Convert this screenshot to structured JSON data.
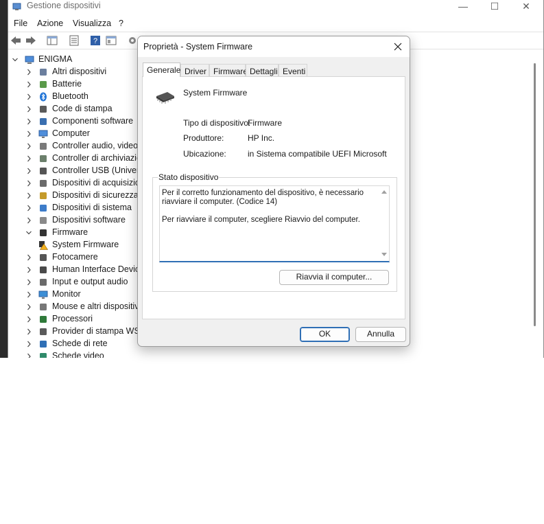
{
  "window": {
    "title": "Gestione dispositivi",
    "controls": {
      "minimize": "—",
      "maximize": "☐",
      "close": "✕"
    }
  },
  "menu": [
    "File",
    "Azione",
    "Visualizza",
    "?"
  ],
  "toolbar_icons": [
    "back-arrow-icon",
    "forward-arrow-icon",
    "show-hide-tree-icon",
    "properties-icon",
    "help-icon",
    "view-icon",
    "scan-hardware-icon"
  ],
  "tree": {
    "root": "ENIGMA",
    "items": [
      {
        "label": "Altri dispositivi",
        "icon": "unknown-device-icon",
        "expanded": false
      },
      {
        "label": "Batterie",
        "icon": "battery-icon",
        "expanded": false
      },
      {
        "label": "Bluetooth",
        "icon": "bluetooth-icon",
        "expanded": false
      },
      {
        "label": "Code di stampa",
        "icon": "printer-icon",
        "expanded": false
      },
      {
        "label": "Componenti software",
        "icon": "software-component-icon",
        "expanded": false
      },
      {
        "label": "Computer",
        "icon": "computer-icon",
        "expanded": false
      },
      {
        "label": "Controller audio, video e",
        "icon": "audio-icon",
        "expanded": false
      },
      {
        "label": "Controller di archiviazio",
        "icon": "storage-icon",
        "expanded": false
      },
      {
        "label": "Controller USB (Universa",
        "icon": "usb-icon",
        "expanded": false
      },
      {
        "label": "Dispositivi di acquisizion",
        "icon": "imaging-icon",
        "expanded": false
      },
      {
        "label": "Dispositivi di sicurezza",
        "icon": "security-icon",
        "expanded": false
      },
      {
        "label": "Dispositivi di sistema",
        "icon": "system-icon",
        "expanded": false
      },
      {
        "label": "Dispositivi software",
        "icon": "software-device-icon",
        "expanded": false
      },
      {
        "label": "Firmware",
        "icon": "chip-icon",
        "expanded": true
      },
      {
        "label": "System Firmware",
        "icon": "warning-chip-icon",
        "child": true
      },
      {
        "label": "Fotocamere",
        "icon": "camera-icon",
        "expanded": false
      },
      {
        "label": "Human Interface Device",
        "icon": "hid-icon",
        "expanded": false
      },
      {
        "label": "Input e output audio",
        "icon": "speaker-icon",
        "expanded": false
      },
      {
        "label": "Monitor",
        "icon": "monitor-icon",
        "expanded": false
      },
      {
        "label": "Mouse e altri dispositivi",
        "icon": "mouse-icon",
        "expanded": false
      },
      {
        "label": "Processori",
        "icon": "processor-icon",
        "expanded": false
      },
      {
        "label": "Provider di stampa WSD",
        "icon": "printer-icon",
        "expanded": false
      },
      {
        "label": "Schede di rete",
        "icon": "network-icon",
        "expanded": false
      },
      {
        "label": "Schede video",
        "icon": "display-adapter-icon",
        "expanded": false
      }
    ]
  },
  "dialog": {
    "title": "Proprietà - System Firmware",
    "tabs": [
      "Generale",
      "Driver",
      "Firmware",
      "Dettagli",
      "Eventi"
    ],
    "active_tab": "Generale",
    "device_name": "System Firmware",
    "props": [
      {
        "label": "Tipo di dispositivo:",
        "value": "Firmware"
      },
      {
        "label": "Produttore:",
        "value": "HP Inc."
      },
      {
        "label": "Ubicazione:",
        "value": "in Sistema compatibile UEFI Microsoft"
      }
    ],
    "status_group_label": "Stato dispositivo",
    "status_text": "Per il corretto funzionamento del dispositivo, è necessario riavviare il computer. (Codice 14)\n\nPer riavviare il computer, scegliere Riavvio del computer.",
    "restart_button": "Riavvia il computer...",
    "ok_button": "OK",
    "cancel_button": "Annulla"
  },
  "colors": {
    "accent": "#2f6fb5",
    "warning": "#f2b01e",
    "bluetooth": "#1f73d6"
  }
}
